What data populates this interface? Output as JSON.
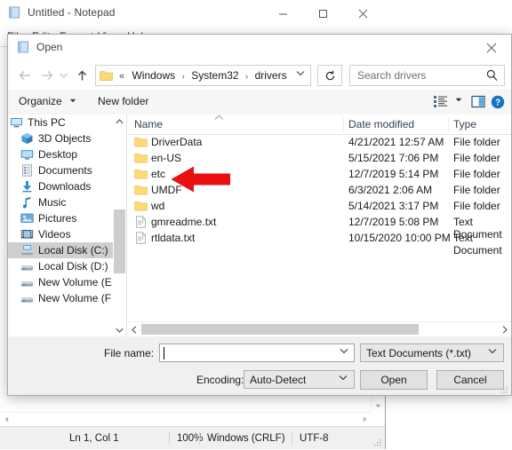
{
  "notepad": {
    "title": "Untitled - Notepad",
    "icon": "notepad-icon",
    "window_buttons": {
      "minimize": "—",
      "maximize": "☐",
      "close": "✕"
    },
    "menu": [
      "File",
      "Edit",
      "Format",
      "View",
      "Help"
    ],
    "statusbar": [
      {
        "label": "Ln 1, Col 1"
      },
      {
        "label": "100%"
      },
      {
        "label": "Windows (CRLF)"
      },
      {
        "label": "UTF-8"
      }
    ]
  },
  "dialog": {
    "title": "Open",
    "icon": "notepad-icon",
    "close_label": "✕",
    "nav": {
      "back": "←",
      "forward": "→",
      "recent": "⌄",
      "up": "↑",
      "refresh": "↻"
    },
    "address": {
      "chevrons": "«",
      "crumbs": [
        "Windows",
        "System32",
        "drivers"
      ],
      "separator": "›",
      "dropdown": "⌄"
    },
    "search": {
      "placeholder": "Search drivers",
      "value": "",
      "icon": "search-icon"
    },
    "toolbar": {
      "organize": "Organize",
      "organize_arrow": "▾",
      "new_folder": "New folder",
      "view_icon": "view-options-icon",
      "view_arrow": "▾",
      "pane_icon": "preview-pane-icon",
      "help_icon": "help-icon",
      "help_glyph": "?"
    },
    "sidebar": {
      "scroll_up": "⌃",
      "scroll_down": "⌄",
      "items": [
        {
          "label": "This PC",
          "icon": "this-pc-icon",
          "level": "root",
          "selected": false
        },
        {
          "label": "3D Objects",
          "icon": "3d-objects-icon",
          "level": "child",
          "selected": false
        },
        {
          "label": "Desktop",
          "icon": "desktop-icon",
          "level": "child",
          "selected": false
        },
        {
          "label": "Documents",
          "icon": "documents-icon",
          "level": "child",
          "selected": false
        },
        {
          "label": "Downloads",
          "icon": "downloads-icon",
          "level": "child",
          "selected": false
        },
        {
          "label": "Music",
          "icon": "music-icon",
          "level": "child",
          "selected": false
        },
        {
          "label": "Pictures",
          "icon": "pictures-icon",
          "level": "child",
          "selected": false
        },
        {
          "label": "Videos",
          "icon": "videos-icon",
          "level": "child",
          "selected": false
        },
        {
          "label": "Local Disk (C:)",
          "icon": "system-drive-icon",
          "level": "child",
          "selected": true
        },
        {
          "label": "Local Disk (D:)",
          "icon": "drive-icon",
          "level": "child",
          "selected": false
        },
        {
          "label": "New Volume (E",
          "icon": "drive-icon",
          "level": "child",
          "selected": false
        },
        {
          "label": "New Volume (F",
          "icon": "drive-icon",
          "level": "child",
          "selected": false
        }
      ]
    },
    "filelist": {
      "columns": [
        "Name",
        "Date modified",
        "Type"
      ],
      "sort_indicator": "⌃",
      "rows": [
        {
          "name": "DriverData",
          "date": "4/21/2021 12:57 AM",
          "type": "File folder",
          "icon": "folder-icon"
        },
        {
          "name": "en-US",
          "date": "5/15/2021 7:06 PM",
          "type": "File folder",
          "icon": "folder-icon"
        },
        {
          "name": "etc",
          "date": "12/7/2019 5:14 PM",
          "type": "File folder",
          "icon": "folder-icon"
        },
        {
          "name": "UMDF",
          "date": "6/3/2021 2:06 AM",
          "type": "File folder",
          "icon": "folder-icon"
        },
        {
          "name": "wd",
          "date": "5/14/2021 3:17 PM",
          "type": "File folder",
          "icon": "folder-icon"
        },
        {
          "name": "gmreadme.txt",
          "date": "12/7/2019 5:08 PM",
          "type": "Text Document",
          "icon": "text-file-icon"
        },
        {
          "name": "rtldata.txt",
          "date": "10/15/2020 10:00 PM",
          "type": "Text Document",
          "icon": "text-file-icon"
        }
      ],
      "scroll_left": "‹",
      "scroll_right": "›"
    },
    "form": {
      "filename_label": "File name:",
      "filename_value": "",
      "filename_chevron": "⌄",
      "filter_value": "Text Documents (*.txt)",
      "filter_chevron": "⌄",
      "encoding_label": "Encoding:",
      "encoding_value": "Auto-Detect",
      "encoding_chevron": "⌄",
      "open_button": "Open",
      "cancel_button": "Cancel"
    }
  },
  "annotation": {
    "arrow": "red-left-arrow",
    "color": "#e8110f",
    "points_at": "etc"
  }
}
